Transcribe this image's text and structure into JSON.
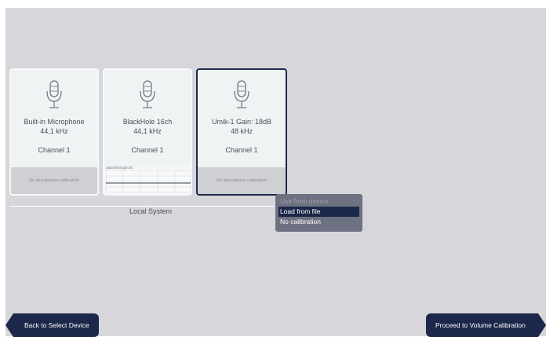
{
  "devices": [
    {
      "name": "Built-in Microphone",
      "rate": "44,1 kHz",
      "channel": "Channel 1",
      "calibration": "No microphone calibration",
      "selected": false
    },
    {
      "name": "BlackHole 16ch",
      "rate": "44,1 kHz",
      "channel": "Channel 1",
      "calibration_file": "passthrough.txt",
      "selected": false
    },
    {
      "name": "Umik-1  Gain: 18dB",
      "rate": "48 kHz",
      "channel": "Channel 1",
      "calibration": "No microphone calibration",
      "selected": true
    }
  ],
  "group_label": "Local System",
  "calibration_menu": {
    "items": [
      {
        "label": "Use from device",
        "state": "disabled"
      },
      {
        "label": "Load from file",
        "state": "highlighted"
      },
      {
        "label": "No calibration",
        "state": "normal"
      }
    ]
  },
  "nav": {
    "back_label": "Back to Select Device",
    "next_label": "Proceed to Volume Calibration"
  },
  "colors": {
    "background": "#d7d6db",
    "card": "#eef3f4",
    "accent": "#1c2849",
    "menu": "#6e7181"
  },
  "icons": [
    "microphone-icon",
    "back-arrow-icon",
    "forward-arrow-icon"
  ]
}
